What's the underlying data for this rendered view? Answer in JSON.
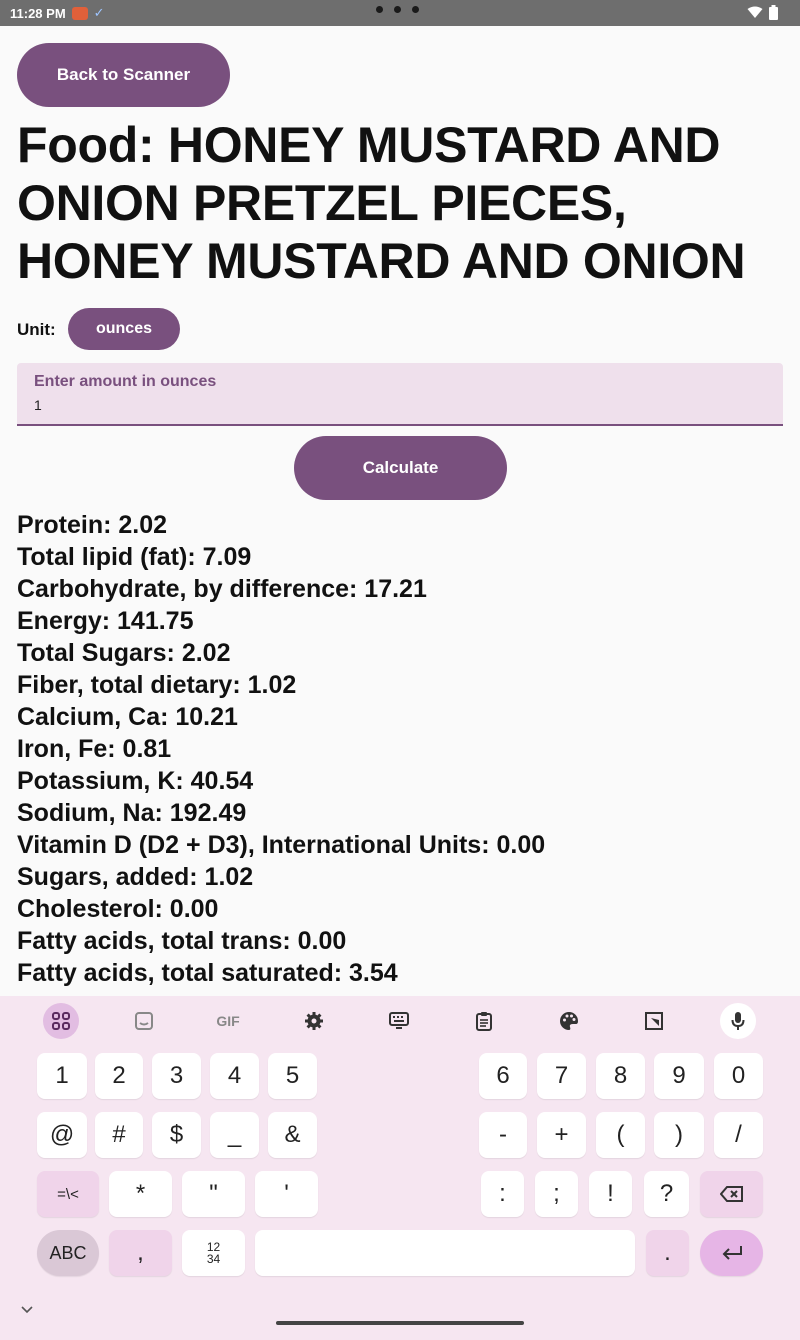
{
  "status_bar": {
    "time": "11:28 PM"
  },
  "header": {
    "back_label": "Back to Scanner"
  },
  "food": {
    "title": "Food: HONEY MUSTARD AND ONION PRETZEL PIECES, HONEY MUSTARD AND ONION"
  },
  "unit": {
    "label": "Unit:",
    "value": "ounces"
  },
  "amount": {
    "label": "Enter amount in ounces",
    "value": "1"
  },
  "calculate_label": "Calculate",
  "nutrients": [
    "Protein: 2.02",
    "Total lipid (fat): 7.09",
    "Carbohydrate, by difference: 17.21",
    "Energy: 141.75",
    "Total Sugars: 2.02",
    "Fiber, total dietary: 1.02",
    "Calcium, Ca: 10.21",
    "Iron, Fe: 0.81",
    "Potassium, K: 40.54",
    "Sodium, Na: 192.49",
    "Vitamin D (D2 + D3), International Units: 0.00",
    "Sugars, added: 1.02",
    "Cholesterol: 0.00",
    "Fatty acids, total trans: 0.00",
    "Fatty acids, total saturated: 3.54"
  ],
  "keyboard": {
    "toolbar": {
      "gif": "GIF"
    },
    "row1": [
      "1",
      "2",
      "3",
      "4",
      "5",
      "6",
      "7",
      "8",
      "9",
      "0"
    ],
    "row2": [
      "@",
      "#",
      "$",
      "_",
      "&",
      "-",
      "+",
      "(",
      ")",
      "/"
    ],
    "row3": [
      "=\\<",
      "*",
      "\"",
      "'",
      ":",
      ";",
      "!",
      "?"
    ],
    "row4": {
      "abc": "ABC",
      "comma": ",",
      "numpad_top": "12",
      "numpad_bottom": "34",
      "period": "."
    }
  },
  "colors": {
    "accent": "#79507e",
    "keyboard_bg": "#f6e6f1",
    "field_bg": "#efe0ec"
  }
}
